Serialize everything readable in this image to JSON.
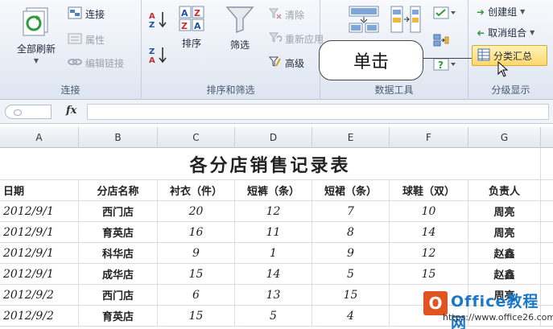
{
  "ribbon": {
    "connections": {
      "refresh_all": "全部刷新",
      "connections": "连接",
      "properties": "属性",
      "edit_links": "编辑链接",
      "label": "连接"
    },
    "sort_filter": {
      "sort": "排序",
      "filter": "筛选",
      "clear": "清除",
      "reapply": "重新应用",
      "advanced": "高级",
      "label": "排序和筛选"
    },
    "data_tools": {
      "label": "数据工具"
    },
    "outline": {
      "group": "创建组",
      "ungroup": "取消组合",
      "subtotal": "分类汇总",
      "label": "分级显示"
    }
  },
  "callout": {
    "text": "单击"
  },
  "formula_bar": {
    "fx": "fx",
    "value": ""
  },
  "sheet": {
    "columns": [
      "A",
      "B",
      "C",
      "D",
      "E",
      "F",
      "G"
    ],
    "title": "各分店销售记录表",
    "headers": [
      "日期",
      "分店名称",
      "衬衣（件）",
      "短裤（条）",
      "短裙（条）",
      "球鞋（双）",
      "负责人"
    ],
    "rows": [
      [
        "2012/9/1",
        "西门店",
        "20",
        "12",
        "7",
        "10",
        "周亮"
      ],
      [
        "2012/9/1",
        "育英店",
        "16",
        "11",
        "8",
        "14",
        "周亮"
      ],
      [
        "2012/9/1",
        "科华店",
        "9",
        "1",
        "9",
        "12",
        "赵鑫"
      ],
      [
        "2012/9/1",
        "成华店",
        "15",
        "14",
        "5",
        "15",
        "赵鑫"
      ],
      [
        "2012/9/2",
        "西门店",
        "6",
        "13",
        "15",
        "",
        "周亮"
      ],
      [
        "2012/9/2",
        "育英店",
        "15",
        "5",
        "4",
        "",
        ""
      ]
    ]
  },
  "watermark": {
    "logo": "O",
    "name": "Office教程网",
    "url": "https://www.office26.com"
  },
  "colors": {
    "accent": "#ffd86b",
    "ribbon_bg": "#e9eef6",
    "watermark_blue": "#1b78c8",
    "watermark_orange": "#e0541f"
  }
}
